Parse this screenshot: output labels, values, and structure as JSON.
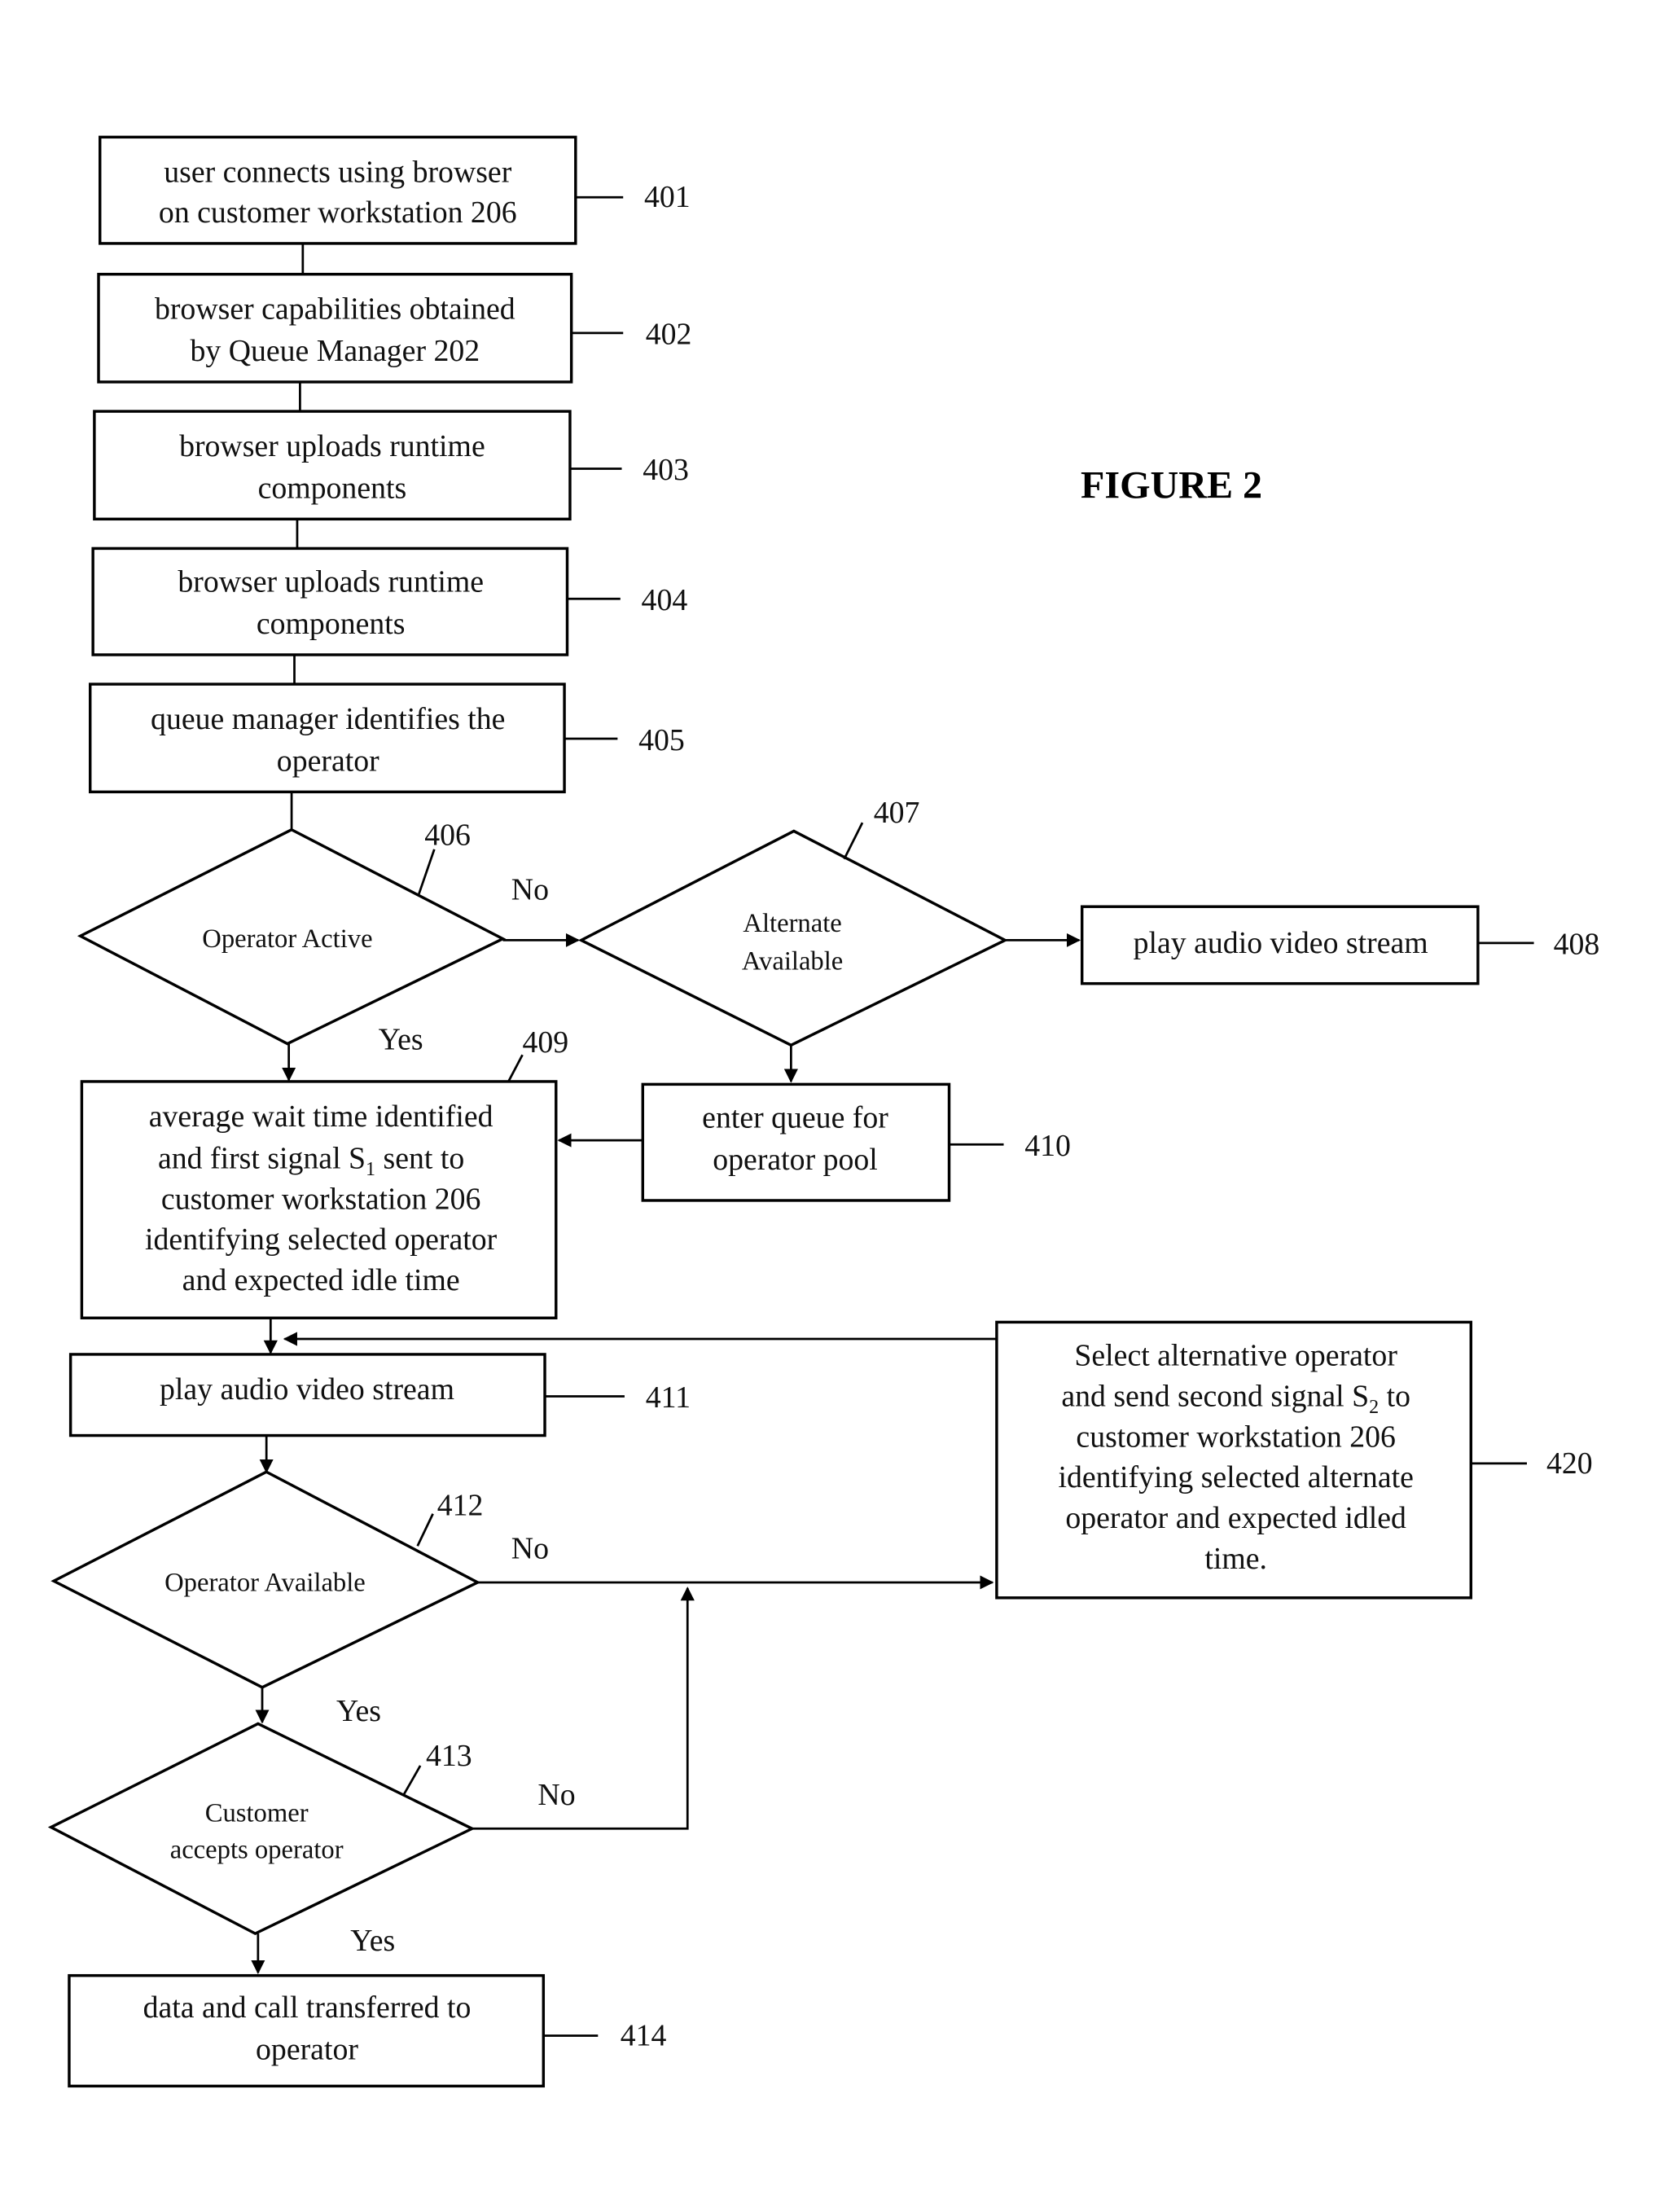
{
  "figure_title": "FIGURE 2",
  "steps": {
    "s401": {
      "ref": "401",
      "lines": [
        "user connects using browser",
        "on customer workstation 206"
      ]
    },
    "s402": {
      "ref": "402",
      "lines": [
        "browser capabilities obtained",
        "by Queue Manager 202"
      ]
    },
    "s403": {
      "ref": "403",
      "lines": [
        "browser uploads runtime",
        "components"
      ]
    },
    "s404": {
      "ref": "404",
      "lines": [
        "browser uploads runtime",
        "components"
      ]
    },
    "s405": {
      "ref": "405",
      "lines": [
        "queue manager identifies the",
        "operator"
      ]
    },
    "s406": {
      "ref": "406",
      "lines": [
        "Operator Active"
      ]
    },
    "s407": {
      "ref": "407",
      "lines": [
        "Alternate",
        "Available"
      ]
    },
    "s408": {
      "ref": "408",
      "lines": [
        "play audio video stream"
      ]
    },
    "s409": {
      "ref": "409",
      "lines": [
        "average wait time identified",
        "and first signal S",
        "1",
        " sent to",
        "customer workstation 206",
        "identifying selected operator",
        "and expected idle time"
      ]
    },
    "s410": {
      "ref": "410",
      "lines": [
        "enter queue for",
        "operator pool"
      ]
    },
    "s411": {
      "ref": "411",
      "lines": [
        "play audio video stream"
      ]
    },
    "s412": {
      "ref": "412",
      "lines": [
        "Operator Available"
      ]
    },
    "s413": {
      "ref": "413",
      "lines": [
        "Customer",
        "accepts operator"
      ]
    },
    "s414": {
      "ref": "414",
      "lines": [
        "data and call transferred to",
        "operator"
      ]
    },
    "s420": {
      "ref": "420",
      "lines": [
        "Select alternative operator",
        "and send second signal S",
        "2",
        " to",
        "customer workstation 206",
        "identifying selected alternate",
        "operator and expected idled",
        "time."
      ]
    }
  },
  "branch_labels": {
    "no": "No",
    "yes": "Yes"
  }
}
